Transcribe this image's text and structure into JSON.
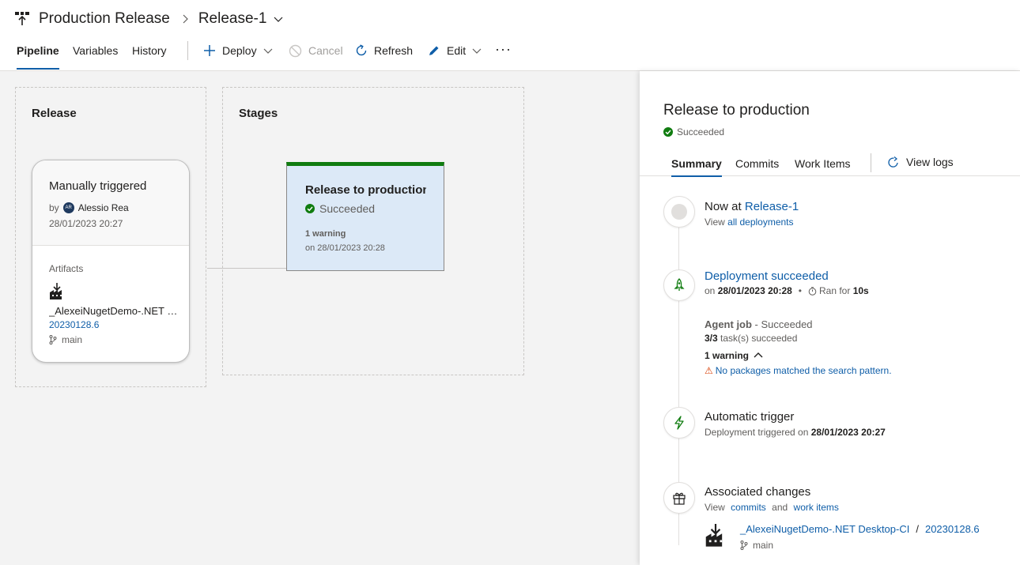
{
  "header": {
    "pipeline_name": "Production Release",
    "release_name": "Release-1"
  },
  "tabs": {
    "pipeline": "Pipeline",
    "variables": "Variables",
    "history": "History"
  },
  "toolbar": {
    "deploy": "Deploy",
    "cancel": "Cancel",
    "refresh": "Refresh",
    "edit": "Edit",
    "more": "···"
  },
  "canvas": {
    "release_heading": "Release",
    "stages_heading": "Stages",
    "trigger_card": {
      "title": "Manually triggered",
      "by_prefix": "by",
      "avatar_initials": "AR",
      "user": "Alessio Rea",
      "date": "28/01/2023 20:27",
      "artifacts_label": "Artifacts",
      "artifact_name": "_AlexeiNugetDemo-.NET Desktop-CI",
      "artifact_version": "20230128.6",
      "branch": "main"
    },
    "stage_card": {
      "title": "Release to production",
      "status": "Succeeded",
      "warning": "1 warning",
      "date": "on 28/01/2023 20:28"
    }
  },
  "panel": {
    "title": "Release to production",
    "status": "Succeeded",
    "tabs": {
      "summary": "Summary",
      "commits": "Commits",
      "work_items": "Work Items"
    },
    "view_logs": "View logs",
    "now": {
      "prefix": "Now at ",
      "release": "Release-1",
      "view_prefix": "View ",
      "view_link": "all deployments"
    },
    "deployment": {
      "heading": "Deployment succeeded",
      "on_prefix": "on ",
      "date": "28/01/2023 20:28",
      "dot": "•",
      "ran_prefix": "Ran for ",
      "duration": "10s"
    },
    "agent_job": {
      "name": "Agent job",
      "status": " - Succeeded",
      "tasks_count": "3/3",
      "tasks_suffix": " task(s) succeeded",
      "warning": "1 warning",
      "warning_message": "No packages matched the search pattern."
    },
    "trigger": {
      "heading": "Automatic trigger",
      "prefix": "Deployment triggered on ",
      "date": "28/01/2023 20:27"
    },
    "changes": {
      "heading": "Associated changes",
      "view": "View",
      "commits": "commits",
      "and": "and",
      "work_items": "work items",
      "artifact": "_AlexeiNugetDemo-.NET Desktop-CI",
      "slash": "/",
      "version": "20230128.6",
      "branch": "main"
    }
  },
  "colors": {
    "accent": "#0f5ea8",
    "success": "#107c10",
    "stage_bg": "#dce9f7",
    "warning": "#d83b01"
  }
}
